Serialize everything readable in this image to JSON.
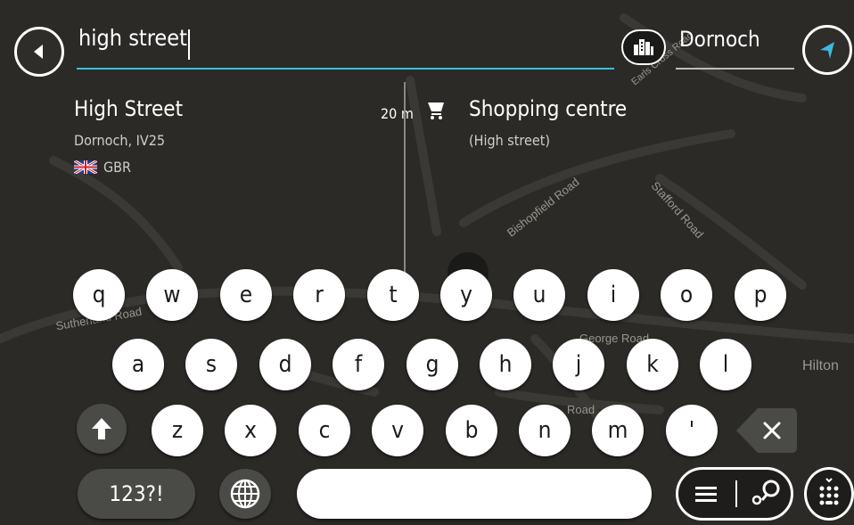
{
  "search": {
    "query": "high street",
    "location": "Dornoch"
  },
  "results": [
    {
      "title": "High Street",
      "subtitle": "Dornoch, IV25",
      "country": "GBR",
      "distance": "20 m"
    },
    {
      "title": "Shopping centre",
      "subtitle": "(High street)"
    }
  ],
  "map_labels": [
    "Bishopfield Road",
    "Stafford Road",
    "Earls Cross Road",
    "Hilton",
    "Sutherland Road",
    "Road",
    "George Road"
  ],
  "keyboard": {
    "row1": [
      "q",
      "w",
      "e",
      "r",
      "t",
      "y",
      "u",
      "i",
      "o",
      "p"
    ],
    "row2": [
      "a",
      "s",
      "d",
      "f",
      "g",
      "h",
      "j",
      "k",
      "l"
    ],
    "row3": [
      "z",
      "x",
      "c",
      "v",
      "b",
      "n",
      "m",
      "'"
    ],
    "numbers_label": "123?!"
  },
  "icons": {
    "back": "back-arrow-icon",
    "poi": "city-poi-icon",
    "navigate": "navigation-arrow-icon",
    "shopping": "shopping-cart-icon",
    "flag": "uk-flag-icon",
    "shift": "shift-arrow-icon",
    "backspace": "backspace-icon",
    "globe": "globe-icon",
    "list": "list-icon",
    "map_pin": "map-pin-icon",
    "keyboard_hide": "keyboard-hide-icon"
  },
  "colors": {
    "accent": "#37c3d6",
    "map_bg": "#2b2a27",
    "nav_arrow": "#3fb8e0"
  }
}
